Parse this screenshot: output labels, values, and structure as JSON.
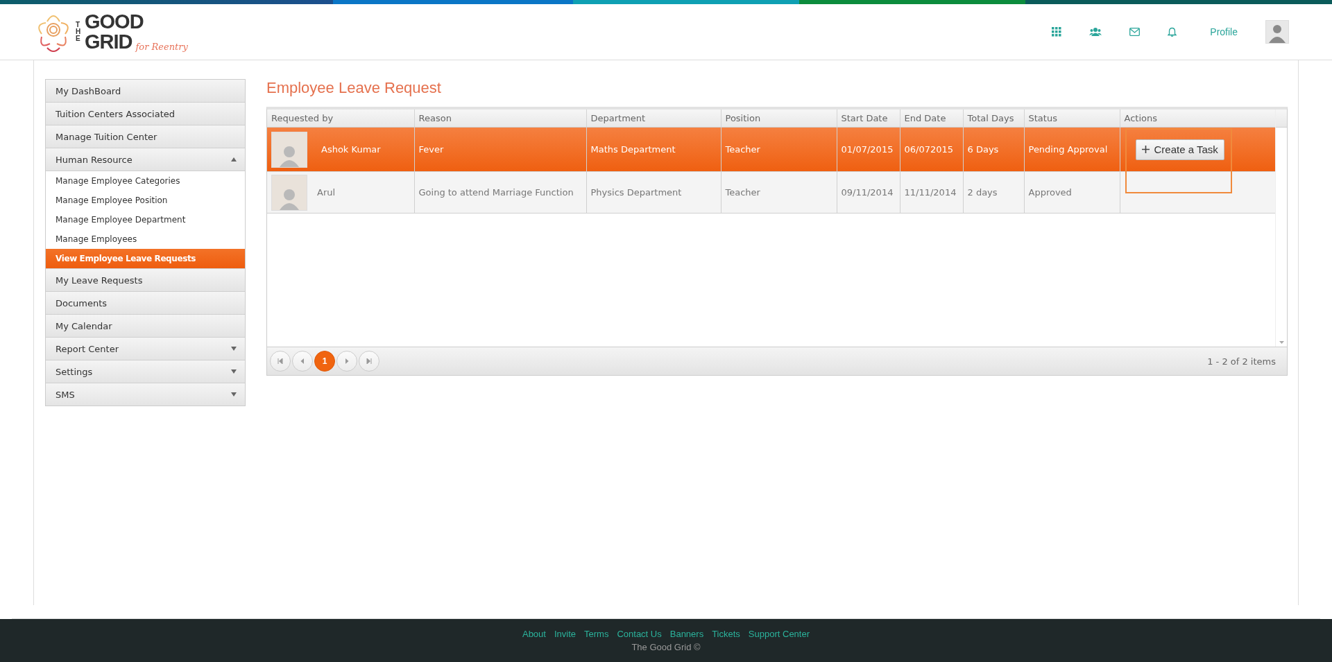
{
  "logo": {
    "the": "THE",
    "word1": "GOOD",
    "word2": "GRID",
    "tagline": "for Reentry"
  },
  "header": {
    "profile_link": "Profile"
  },
  "sidebar": {
    "items": [
      {
        "label": "My DashBoard",
        "kind": "link"
      },
      {
        "label": "Tuition Centers Associated",
        "kind": "link"
      },
      {
        "label": "Manage Tuition Center",
        "kind": "link"
      },
      {
        "label": "Human Resource",
        "kind": "group",
        "expanded": true,
        "children": [
          {
            "label": "Manage Employee Categories",
            "selected": false
          },
          {
            "label": "Manage Employee Position",
            "selected": false
          },
          {
            "label": "Manage Employee Department",
            "selected": false
          },
          {
            "label": "Manage Employees",
            "selected": false
          },
          {
            "label": "View Employee Leave Requests",
            "selected": true
          }
        ]
      },
      {
        "label": "My Leave Requests",
        "kind": "link"
      },
      {
        "label": "Documents",
        "kind": "link"
      },
      {
        "label": "My Calendar",
        "kind": "link"
      },
      {
        "label": "Report Center",
        "kind": "group",
        "expanded": false
      },
      {
        "label": "Settings",
        "kind": "group",
        "expanded": false
      },
      {
        "label": "SMS",
        "kind": "group",
        "expanded": false
      }
    ]
  },
  "page_title": "Employee Leave Request",
  "table": {
    "columns": [
      "Requested by",
      "Reason",
      "Department",
      "Position",
      "Start Date",
      "End Date",
      "Total Days",
      "Status",
      "Actions"
    ],
    "rows": [
      {
        "selected": true,
        "name": "Ashok Kumar",
        "reason": "Fever",
        "department": "Maths Department",
        "position": "Teacher",
        "start_date": "01/07/2015",
        "end_date": "06/072015",
        "total_days": "6 Days",
        "status": "Pending Approval",
        "action": "Create a Task",
        "action_highlighted": true
      },
      {
        "selected": false,
        "name": "Arul",
        "reason": "Going to attend Marriage Function",
        "department": "Physics Department",
        "position": "Teacher",
        "start_date": "09/11/2014",
        "end_date": "11/11/2014",
        "total_days": "2 days",
        "status": "Approved"
      }
    ]
  },
  "pager": {
    "pages": [
      {
        "label": "1",
        "selected": true
      }
    ],
    "info": "1 - 2 of 2 items"
  },
  "footer": {
    "links": [
      "About",
      "Invite",
      "Terms",
      "Contact Us",
      "Banners",
      "Tickets",
      "Support Center"
    ],
    "copyright": "The Good Grid ©"
  }
}
